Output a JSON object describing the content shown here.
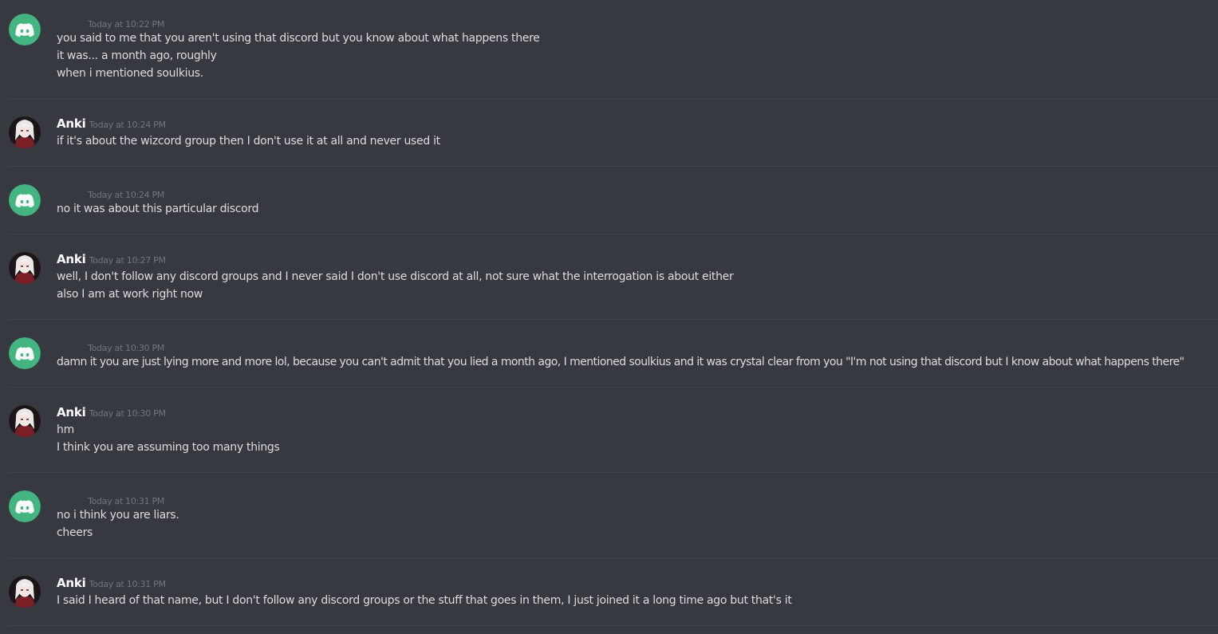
{
  "colors": {
    "background": "#36393f",
    "discord_blurple_green": "#43b581",
    "text": "#dcddde",
    "timestamp": "#72767d",
    "divider": "#40434a"
  },
  "messages": [
    {
      "author": "",
      "avatar": "discord-logo-icon",
      "timestamp": "Today at 10:22 PM",
      "lines": [
        "you said to me that you aren't using that discord but you know about what happens there",
        "it was... a month ago, roughly",
        "when i mentioned soulkius."
      ]
    },
    {
      "author": "Anki",
      "avatar": "anki-avatar",
      "timestamp": "Today at 10:24 PM",
      "lines": [
        "if it's about the wizcord group then I don't use it at all and never used it"
      ]
    },
    {
      "author": "",
      "avatar": "discord-logo-icon",
      "timestamp": "Today at 10:24 PM",
      "lines": [
        "no it was about this particular discord"
      ]
    },
    {
      "author": "Anki",
      "avatar": "anki-avatar",
      "timestamp": "Today at 10:27 PM",
      "lines": [
        "well, I don't follow any discord groups and I never said I don't use discord at all, not sure what the interrogation is about either",
        "also I am at work right now"
      ]
    },
    {
      "author": "",
      "avatar": "discord-logo-icon",
      "timestamp": "Today at 10:30 PM",
      "lines": [
        "damn it you are just lying more and more lol, because you can't admit that you lied a month ago, I mentioned soulkius and it was crystal clear from you \"I'm not using that discord but I know about what happens there\""
      ]
    },
    {
      "author": "Anki",
      "avatar": "anki-avatar",
      "timestamp": "Today at 10:30 PM",
      "lines": [
        "hm",
        "I think you are assuming too many things"
      ]
    },
    {
      "author": "",
      "avatar": "discord-logo-icon",
      "timestamp": "Today at 10:31 PM",
      "lines": [
        "no i think you are liars.",
        "cheers"
      ]
    },
    {
      "author": "Anki",
      "avatar": "anki-avatar",
      "timestamp": "Today at 10:31 PM",
      "lines": [
        "I said I heard of that name, but I don't follow any discord groups or the stuff that goes in them, I just joined it a long time ago but that's it"
      ]
    }
  ]
}
